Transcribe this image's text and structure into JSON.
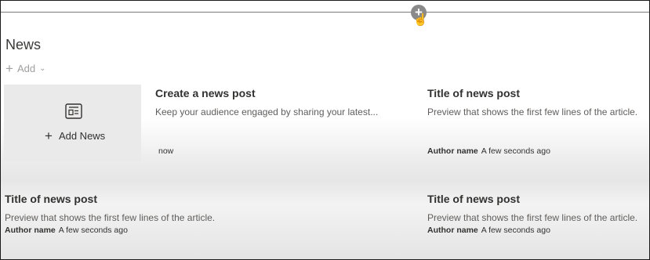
{
  "section": {
    "title": "News",
    "add_label": "Add"
  },
  "add_news": {
    "label": "Add News"
  },
  "posts": [
    {
      "title": "Create a news post",
      "preview": "Keep your audience engaged by sharing your latest...",
      "author": "",
      "time": "now"
    },
    {
      "title": "Title of news post",
      "preview": "Preview that shows the first few lines of the article.",
      "author": "Author name",
      "time": "A few seconds ago"
    },
    {
      "title": "Title of news post",
      "preview": "Preview that shows the first few lines of the article.",
      "author": "Author name",
      "time": "A few seconds ago"
    },
    {
      "title": "Title of news post",
      "preview": "Preview that shows the first few lines of the article.",
      "author": "Author name",
      "time": "A few seconds ago"
    }
  ],
  "icons": {
    "add_section": "plus-circle-icon",
    "cursor": "hand-pointer-icon",
    "news": "newspaper-icon"
  }
}
